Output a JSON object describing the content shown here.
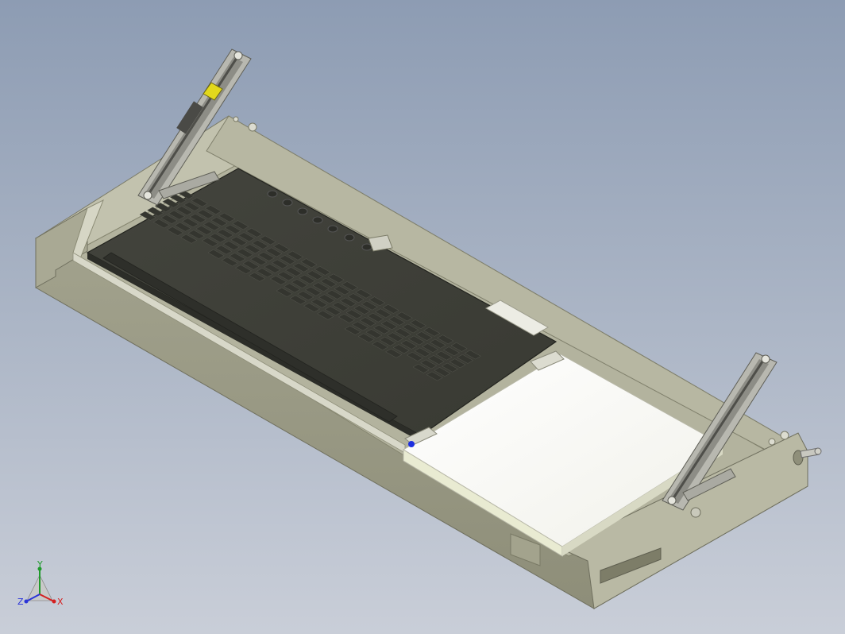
{
  "viewport": {
    "background_top": "#8d9cb3",
    "background_bottom": "#c9ced8"
  },
  "model": {
    "tray_color": "#a7a792",
    "tray_light": "#c6c6b3",
    "tray_dark": "#86866f",
    "keyboard_color": "#3f4039",
    "key_color": "#34352f",
    "pad_color": "#f6f6ef",
    "actuator_accent": "#e2d81c"
  },
  "triad": {
    "labels": {
      "x": "X",
      "y": "Y",
      "z": "Z"
    },
    "colors": {
      "x": "#d42020",
      "y": "#1f9a2b",
      "z": "#2b35d8"
    }
  }
}
